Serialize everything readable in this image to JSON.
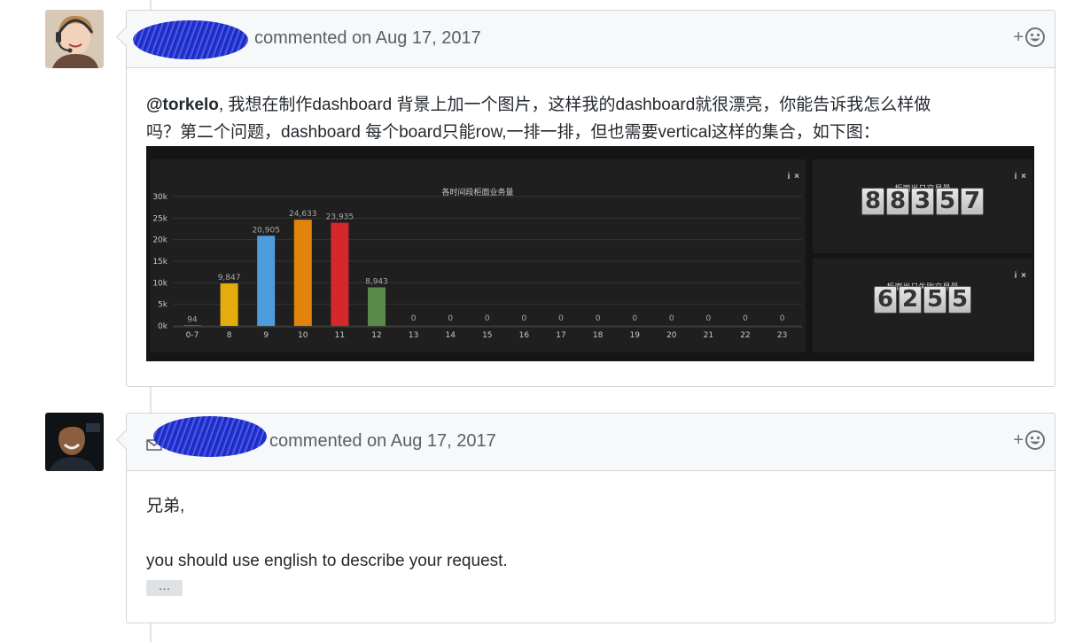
{
  "comment1": {
    "action": "commented on Aug 17, 2017",
    "mention": "@torkelo",
    "body_line1": ", 我想在制作dashboard 背景上加一个图片，这样我的dashboard就很漂亮，你能告诉我怎么样做",
    "body_line2": "吗？第二个问题，dashboard 每个board只能row,一排一排，但也需要vertical这样的集合，如下图：",
    "reaction_plus": "+",
    "reaction_icon": "smiley-icon",
    "dashboard": {
      "panel_icons": "i ×",
      "chart_data": {
        "type": "bar",
        "title": "各时间段柜面业务量",
        "categories": [
          "0-7",
          "8",
          "9",
          "10",
          "11",
          "12",
          "13",
          "14",
          "15",
          "16",
          "17",
          "18",
          "19",
          "20",
          "21",
          "22",
          "23"
        ],
        "values": [
          94,
          9847,
          20905,
          24633,
          23935,
          8943,
          0,
          0,
          0,
          0,
          0,
          0,
          0,
          0,
          0,
          0,
          0
        ],
        "value_labels": [
          "94",
          "9,847",
          "20,905",
          "24,633",
          "23,935",
          "8,943",
          "0",
          "0",
          "0",
          "0",
          "0",
          "0",
          "0",
          "0",
          "0",
          "0",
          "0"
        ],
        "colors": [
          "#7eb26d",
          "#e5ac0e",
          "#4d9dde",
          "#e0840c",
          "#d4282b",
          "#5a8a49",
          "#7eb26d",
          "#7eb26d",
          "#7eb26d",
          "#7eb26d",
          "#7eb26d",
          "#7eb26d",
          "#7eb26d",
          "#7eb26d",
          "#7eb26d",
          "#7eb26d",
          "#7eb26d"
        ],
        "yticks": [
          "0k",
          "5k",
          "10k",
          "15k",
          "20k",
          "25k",
          "30k"
        ],
        "ylim": [
          0,
          30000
        ],
        "grid": true
      },
      "stat1": {
        "title": "柜面当日交易量",
        "digits": [
          "8",
          "8",
          "3",
          "5",
          "7"
        ]
      },
      "stat2": {
        "title": "柜面当日失败交易量",
        "digits": [
          "6",
          "2",
          "5",
          "5"
        ]
      }
    }
  },
  "comment2": {
    "action": "commented on Aug 17, 2017",
    "line1": "兄弟,",
    "line2": "you should use english to describe your request.",
    "ellipsis": "…",
    "reaction_plus": "+",
    "reaction_icon": "smiley-icon"
  }
}
